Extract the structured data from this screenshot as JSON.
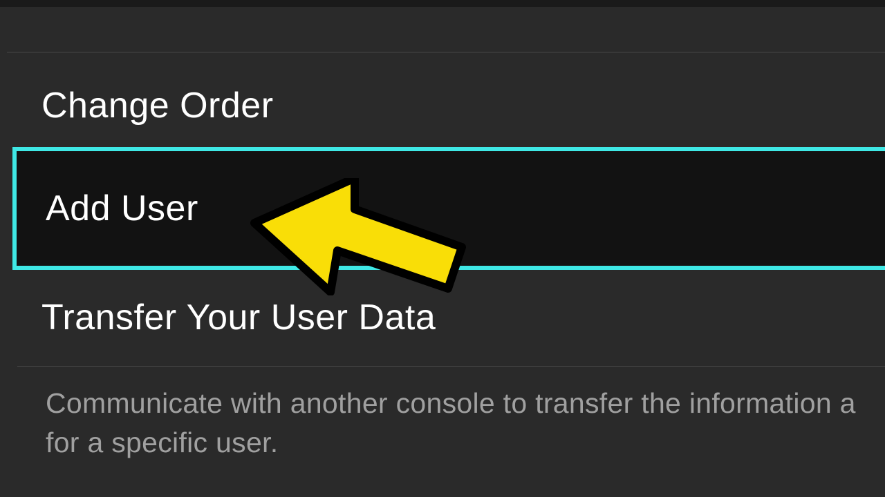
{
  "menu": {
    "change_order": "Change Order",
    "add_user": "Add User",
    "transfer": "Transfer Your User Data"
  },
  "description": "Communicate with another console to transfer the information a for a specific user.",
  "colors": {
    "highlight": "#3fe8e5",
    "arrow_fill": "#f9de07",
    "arrow_stroke": "#000000"
  }
}
